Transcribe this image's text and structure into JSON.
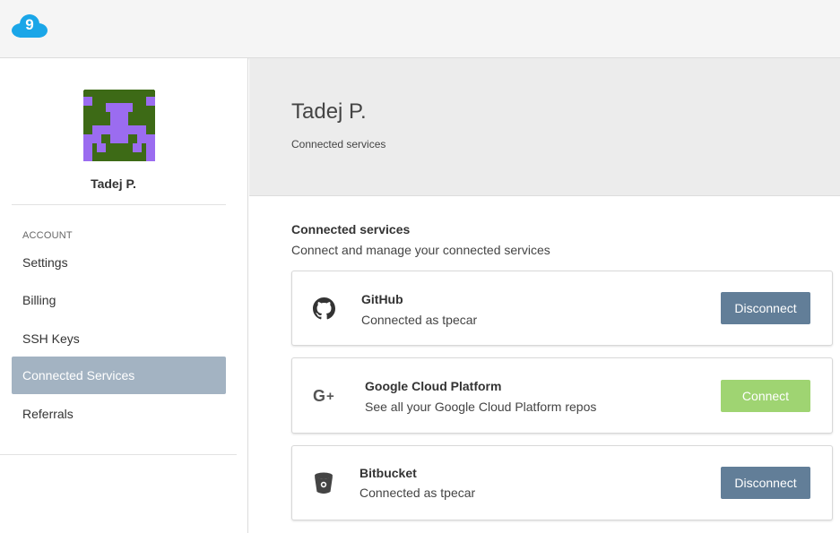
{
  "header": {
    "logo_icon": "cloud9-logo-icon",
    "brand_color": "#1aa6e8"
  },
  "sidebar": {
    "profile_name": "Tadej P.",
    "avatar_colors": {
      "background": "#3d6a16",
      "figure": "#9b6cf0"
    },
    "section_label": "ACCOUNT",
    "items": [
      {
        "label": "Settings",
        "active": false
      },
      {
        "label": "Billing",
        "active": false
      },
      {
        "label": "SSH Keys",
        "active": false
      },
      {
        "label": "Connected Services",
        "active": true
      },
      {
        "label": "Referrals",
        "active": false
      }
    ]
  },
  "main": {
    "title": "Tadej P.",
    "subtitle": "Connected services",
    "section_title": "Connected services",
    "section_description": "Connect and manage your connected services",
    "services": [
      {
        "name": "GitHub",
        "status": "Connected as tpecar",
        "action": "Disconnect",
        "icon": "github-icon"
      },
      {
        "name": "Google Cloud Platform",
        "status": "See all your Google Cloud Platform repos",
        "action": "Connect",
        "icon": "google-plus-icon"
      },
      {
        "name": "Bitbucket",
        "status": "Connected as tpecar",
        "action": "Disconnect",
        "icon": "bitbucket-icon"
      }
    ]
  },
  "colors": {
    "disconnect_button": "#627e98",
    "connect_button": "#9fd472",
    "active_nav": "#a3b3c2"
  }
}
